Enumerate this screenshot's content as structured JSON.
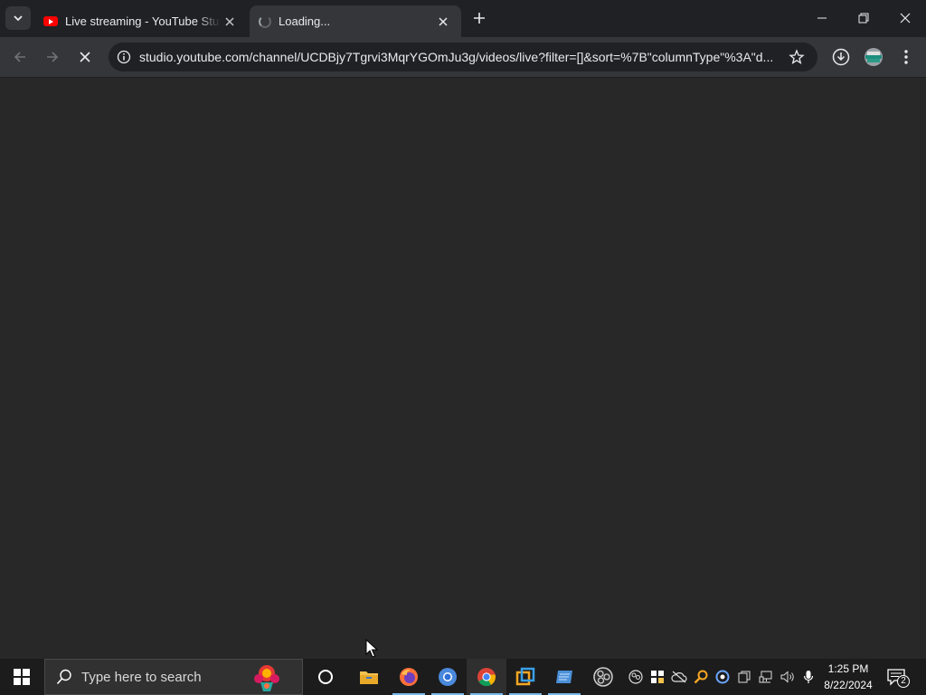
{
  "tabs": [
    {
      "title": "Live streaming - YouTube Studio"
    },
    {
      "title": "Loading..."
    }
  ],
  "address_bar": {
    "url": "studio.youtube.com/channel/UCDBjy7Tgrvi3MqrYGOmJu3g/videos/live?filter=[]&sort=%7B\"columnType\"%3A\"d..."
  },
  "taskbar": {
    "search_placeholder": "Type here to search",
    "time": "1:25 PM",
    "date": "8/22/2024",
    "notification_count": "2"
  }
}
